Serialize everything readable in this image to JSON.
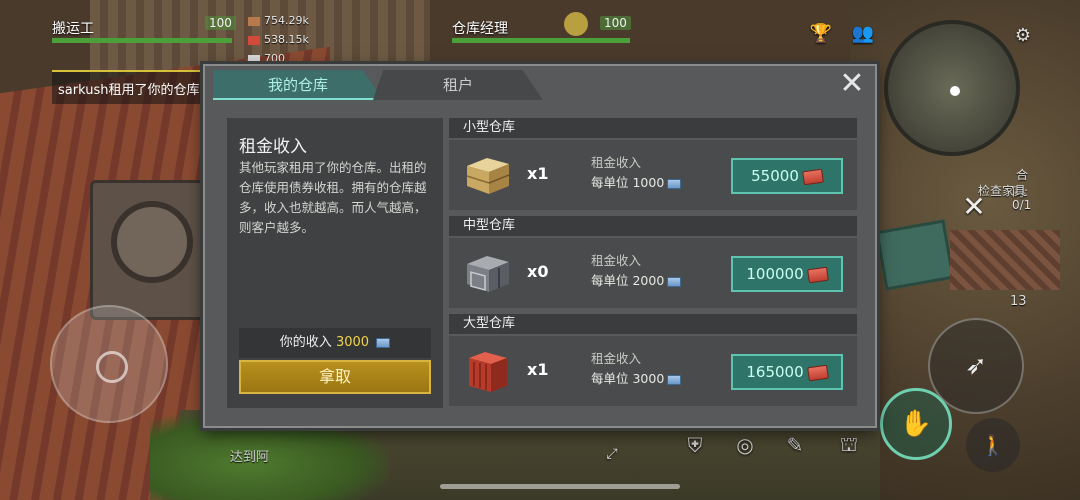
{
  "hud": {
    "stat_left": {
      "label": "搬运工",
      "value": "100"
    },
    "stat_right": {
      "label": "仓库经理",
      "value": "100"
    },
    "resources": [
      "754.29k",
      "538.15k",
      "700"
    ],
    "chat_message": "sarkush租用了你的仓库",
    "side_quest": {
      "title": "合同:",
      "task": "检查家具",
      "progress": "0/1"
    },
    "ammo_count": "13",
    "quick_bar_text": "达到阿"
  },
  "modal": {
    "tabs": [
      "我的仓库",
      "租户"
    ],
    "close_label": "✕",
    "rent_panel": {
      "title": "租金收入",
      "description": "其他玩家租用了你的仓库。出租的仓库使用债券收租。拥有的仓库越多，收入也就越高。而人气越高，则客户越多。",
      "income_label": "你的收入",
      "income_value": "3000",
      "claim_button": "拿取"
    },
    "warehouses": [
      {
        "name": "小型仓库",
        "icon": "wooden-crate-icon",
        "count": "x1",
        "income_label": "租金收入",
        "per_unit": "每单位 1000",
        "button_value": "55000"
      },
      {
        "name": "中型仓库",
        "icon": "metal-crate-icon",
        "count": "x0",
        "income_label": "租金收入",
        "per_unit": "每单位 2000",
        "button_value": "100000"
      },
      {
        "name": "大型仓库",
        "icon": "shipping-container-icon",
        "count": "x1",
        "income_label": "租金收入",
        "per_unit": "每单位 3000",
        "button_value": "165000"
      }
    ]
  },
  "colors": {
    "accent_teal": "#2e7468",
    "claim_gold": "#b8901e",
    "bar_green": "#4ca03a"
  }
}
